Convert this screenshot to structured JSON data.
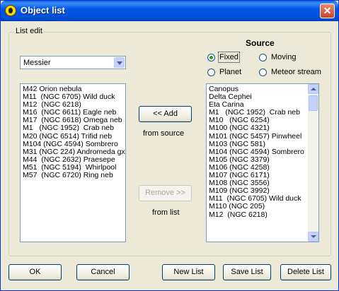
{
  "window": {
    "title": "Object list",
    "close_glyph": "✕"
  },
  "group": {
    "label": "List edit"
  },
  "source": {
    "label": "Source",
    "options": [
      {
        "label": "Fixed",
        "checked": true
      },
      {
        "label": "Moving",
        "checked": false
      },
      {
        "label": "Planet",
        "checked": false
      },
      {
        "label": "Meteor stream",
        "checked": false
      }
    ]
  },
  "catalog_select": {
    "value": "Messier"
  },
  "left_list": {
    "items": [
      "M42 Orion nebula",
      "M11  (NGC 6705) Wild duck",
      "M12  (NGC 6218)",
      "M16  (NGC 6611) Eagle neb",
      "M17  (NGC 6618) Omega neb",
      "M1   (NGC 1952)  Crab neb",
      "M20 (NGC 6514) Trifid neb",
      "M104 (NGC 4594) Sombrero",
      "M31 (NGC 224) Andromeda gx",
      "M44  (NGC 2632) Praesepe",
      "M51  (NGC 5194)  Whirlpool",
      "M57  (NGC 6720) Ring neb"
    ]
  },
  "right_list": {
    "items": [
      "Canopus",
      "Delta Cephei",
      "Eta Carina",
      "M1   (NGC 1952)  Crab neb",
      "M10   (NGC 6254)",
      "M100 (NGC 4321)",
      "M101 (NGC 5457) Pinwheel",
      "M103 (NGC 581)",
      "M104 (NGC 4594) Sombrero",
      "M105 (NGC 3379)",
      "M106 (NGC 4258)",
      "M107 (NGC 6171)",
      "M108 (NGC 3556)",
      "M109 (NGC 3992)",
      "M11  (NGC 6705) Wild duck",
      "M110 (NGC 205)",
      "M12  (NGC 6218)"
    ]
  },
  "actions": {
    "add_label": "<< Add",
    "add_caption": "from source",
    "remove_label": "Remove >>",
    "remove_caption": "from list"
  },
  "footer": {
    "ok": "OK",
    "cancel": "Cancel",
    "new_list": "New List",
    "save_list": "Save List",
    "delete_list": "Delete List"
  }
}
